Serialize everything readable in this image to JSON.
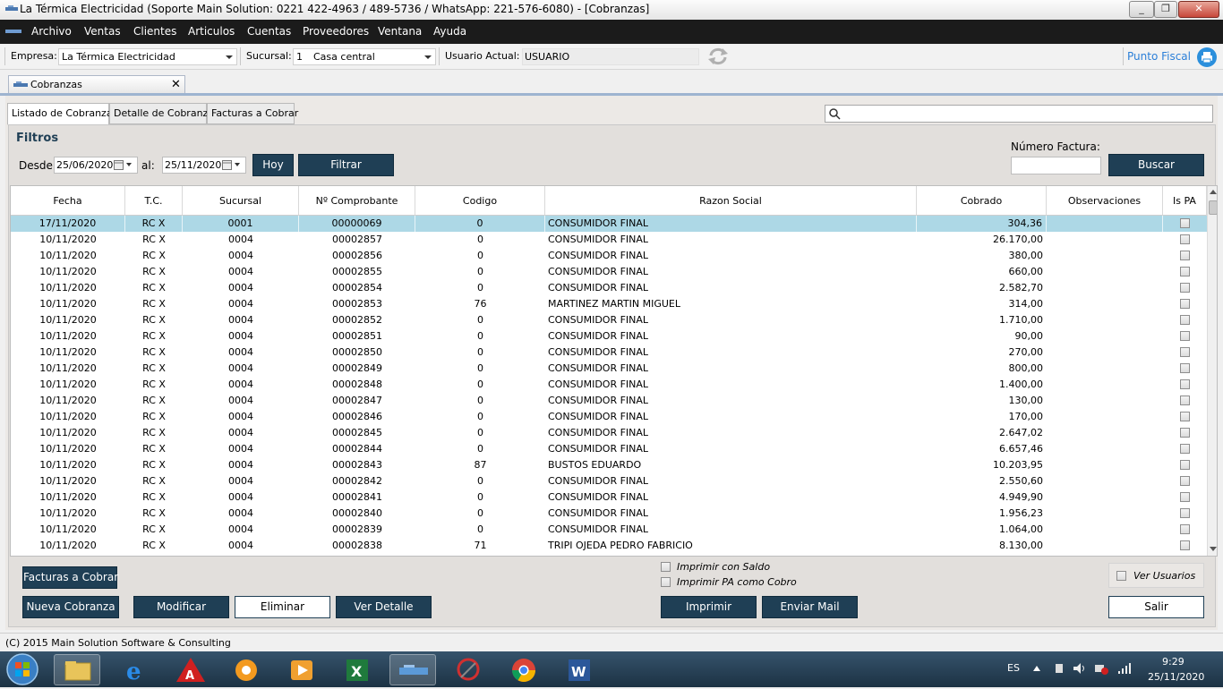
{
  "window": {
    "title": "La Térmica Electricidad (Soporte Main Solution: 0221 422-4963 / 489-5736 / WhatsApp: 221-576-6080) - [Cobranzas]",
    "minimize": "_",
    "restore": "❐",
    "close": "✕"
  },
  "menu": [
    "Archivo",
    "Ventas",
    "Clientes",
    "Articulos",
    "Cuentas",
    "Proveedores",
    "Ventana",
    "Ayuda"
  ],
  "top": {
    "empresa_label": "Empresa:",
    "empresa_value": "La Térmica Electricidad",
    "sucursal_label": "Sucursal:",
    "sucursal_num": "1",
    "sucursal_value": "Casa central",
    "usuario_label": "Usuario Actual:",
    "usuario_value": "USUARIO",
    "punto_fiscal": "Punto Fiscal"
  },
  "doc_tab": {
    "label": "Cobranzas",
    "close": "✕"
  },
  "tabs": [
    "Listado de Cobranzas",
    "Detalle de Cobranza",
    "Facturas a Cobrar"
  ],
  "filters": {
    "title": "Filtros",
    "desde_label": "Desde:",
    "desde_value": "25/06/2020",
    "al_label": "al:",
    "al_value": "25/11/2020",
    "hoy": "Hoy",
    "filtrar": "Filtrar",
    "numero_factura_label": "Número Factura:",
    "numero_factura_value": "",
    "buscar": "Buscar",
    "search_value": ""
  },
  "grid": {
    "columns": [
      "Fecha",
      "T.C.",
      "Sucursal",
      "Nº Comprobante",
      "Codigo",
      "Razon Social",
      "Cobrado",
      "Observaciones",
      "Is PA"
    ],
    "rows": [
      {
        "fecha": "17/11/2020",
        "tc": "RC X",
        "sucursal": "0001",
        "comprobante": "00000069",
        "codigo": "0",
        "razon": "CONSUMIDOR FINAL",
        "cobrado": "304,36",
        "obs": ""
      },
      {
        "fecha": "10/11/2020",
        "tc": "RC X",
        "sucursal": "0004",
        "comprobante": "00002857",
        "codigo": "0",
        "razon": "CONSUMIDOR FINAL",
        "cobrado": "26.170,00",
        "obs": ""
      },
      {
        "fecha": "10/11/2020",
        "tc": "RC X",
        "sucursal": "0004",
        "comprobante": "00002856",
        "codigo": "0",
        "razon": "CONSUMIDOR FINAL",
        "cobrado": "380,00",
        "obs": ""
      },
      {
        "fecha": "10/11/2020",
        "tc": "RC X",
        "sucursal": "0004",
        "comprobante": "00002855",
        "codigo": "0",
        "razon": "CONSUMIDOR FINAL",
        "cobrado": "660,00",
        "obs": ""
      },
      {
        "fecha": "10/11/2020",
        "tc": "RC X",
        "sucursal": "0004",
        "comprobante": "00002854",
        "codigo": "0",
        "razon": "CONSUMIDOR FINAL",
        "cobrado": "2.582,70",
        "obs": ""
      },
      {
        "fecha": "10/11/2020",
        "tc": "RC X",
        "sucursal": "0004",
        "comprobante": "00002853",
        "codigo": "76",
        "razon": "MARTINEZ MARTIN MIGUEL",
        "cobrado": "314,00",
        "obs": ""
      },
      {
        "fecha": "10/11/2020",
        "tc": "RC X",
        "sucursal": "0004",
        "comprobante": "00002852",
        "codigo": "0",
        "razon": "CONSUMIDOR FINAL",
        "cobrado": "1.710,00",
        "obs": ""
      },
      {
        "fecha": "10/11/2020",
        "tc": "RC X",
        "sucursal": "0004",
        "comprobante": "00002851",
        "codigo": "0",
        "razon": "CONSUMIDOR FINAL",
        "cobrado": "90,00",
        "obs": ""
      },
      {
        "fecha": "10/11/2020",
        "tc": "RC X",
        "sucursal": "0004",
        "comprobante": "00002850",
        "codigo": "0",
        "razon": "CONSUMIDOR FINAL",
        "cobrado": "270,00",
        "obs": ""
      },
      {
        "fecha": "10/11/2020",
        "tc": "RC X",
        "sucursal": "0004",
        "comprobante": "00002849",
        "codigo": "0",
        "razon": "CONSUMIDOR FINAL",
        "cobrado": "800,00",
        "obs": ""
      },
      {
        "fecha": "10/11/2020",
        "tc": "RC X",
        "sucursal": "0004",
        "comprobante": "00002848",
        "codigo": "0",
        "razon": "CONSUMIDOR FINAL",
        "cobrado": "1.400,00",
        "obs": ""
      },
      {
        "fecha": "10/11/2020",
        "tc": "RC X",
        "sucursal": "0004",
        "comprobante": "00002847",
        "codigo": "0",
        "razon": "CONSUMIDOR FINAL",
        "cobrado": "130,00",
        "obs": ""
      },
      {
        "fecha": "10/11/2020",
        "tc": "RC X",
        "sucursal": "0004",
        "comprobante": "00002846",
        "codigo": "0",
        "razon": "CONSUMIDOR FINAL",
        "cobrado": "170,00",
        "obs": ""
      },
      {
        "fecha": "10/11/2020",
        "tc": "RC X",
        "sucursal": "0004",
        "comprobante": "00002845",
        "codigo": "0",
        "razon": "CONSUMIDOR FINAL",
        "cobrado": "2.647,02",
        "obs": ""
      },
      {
        "fecha": "10/11/2020",
        "tc": "RC X",
        "sucursal": "0004",
        "comprobante": "00002844",
        "codigo": "0",
        "razon": "CONSUMIDOR FINAL",
        "cobrado": "6.657,46",
        "obs": ""
      },
      {
        "fecha": "10/11/2020",
        "tc": "RC X",
        "sucursal": "0004",
        "comprobante": "00002843",
        "codigo": "87",
        "razon": "BUSTOS EDUARDO",
        "cobrado": "10.203,95",
        "obs": ""
      },
      {
        "fecha": "10/11/2020",
        "tc": "RC X",
        "sucursal": "0004",
        "comprobante": "00002842",
        "codigo": "0",
        "razon": "CONSUMIDOR FINAL",
        "cobrado": "2.550,60",
        "obs": ""
      },
      {
        "fecha": "10/11/2020",
        "tc": "RC X",
        "sucursal": "0004",
        "comprobante": "00002841",
        "codigo": "0",
        "razon": "CONSUMIDOR FINAL",
        "cobrado": "4.949,90",
        "obs": ""
      },
      {
        "fecha": "10/11/2020",
        "tc": "RC X",
        "sucursal": "0004",
        "comprobante": "00002840",
        "codigo": "0",
        "razon": "CONSUMIDOR FINAL",
        "cobrado": "1.956,23",
        "obs": ""
      },
      {
        "fecha": "10/11/2020",
        "tc": "RC X",
        "sucursal": "0004",
        "comprobante": "00002839",
        "codigo": "0",
        "razon": "CONSUMIDOR FINAL",
        "cobrado": "1.064,00",
        "obs": ""
      },
      {
        "fecha": "10/11/2020",
        "tc": "RC X",
        "sucursal": "0004",
        "comprobante": "00002838",
        "codigo": "71",
        "razon": "TRIPI OJEDA PEDRO FABRICIO",
        "cobrado": "8.130,00",
        "obs": ""
      }
    ]
  },
  "bottom": {
    "facturas_a_cobrar": "Facturas a Cobrar",
    "nueva_cobranza": "Nueva Cobranza",
    "modificar": "Modificar",
    "eliminar": "Eliminar",
    "ver_detalle": "Ver Detalle",
    "imprimir_saldo": "Imprimir con Saldo",
    "imprimir_pa": "Imprimir PA como Cobro",
    "imprimir": "Imprimir",
    "enviar_mail": "Enviar Mail",
    "ver_usuarios": "Ver Usuarios",
    "salir": "Salir"
  },
  "status": {
    "text": "(C) 2015 Main Solution Software & Consulting"
  },
  "taskbar": {
    "apps": [
      "start-orb-icon",
      "file-explorer-icon",
      "internet-explorer-icon",
      "autocad-icon",
      "settings-app-icon",
      "media-player-icon",
      "excel-icon",
      "main-solution-app-icon",
      "snipping-tool-icon",
      "chrome-icon",
      "word-icon"
    ],
    "lang": "ES",
    "time": "9:29",
    "date": "25/11/2020"
  },
  "colors": {
    "menubar": "#1b1b1b",
    "button": "#1f3f55",
    "selected_row": "#add8e6",
    "link": "#2b7fd8"
  }
}
